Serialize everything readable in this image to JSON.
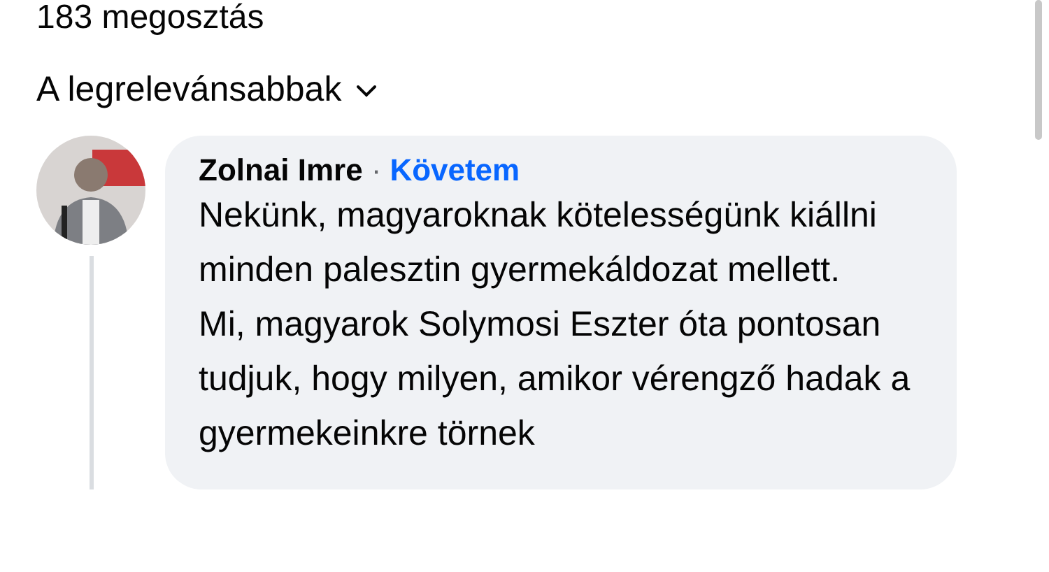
{
  "share_count": "183 megosztás",
  "sort": {
    "label": "A legrelevánsabbak"
  },
  "comment": {
    "author": "Zolnai Imre",
    "separator": "·",
    "follow_label": "Követem",
    "paragraphs": [
      "Nekünk, magyaroknak kötelességünk kiállni minden palesztin gyermekáldozat mellett.",
      "Mi, magyarok Solymosi Eszter óta pontosan tudjuk, hogy milyen, amikor vérengző hadak a gyermekeinkre törnek"
    ]
  }
}
